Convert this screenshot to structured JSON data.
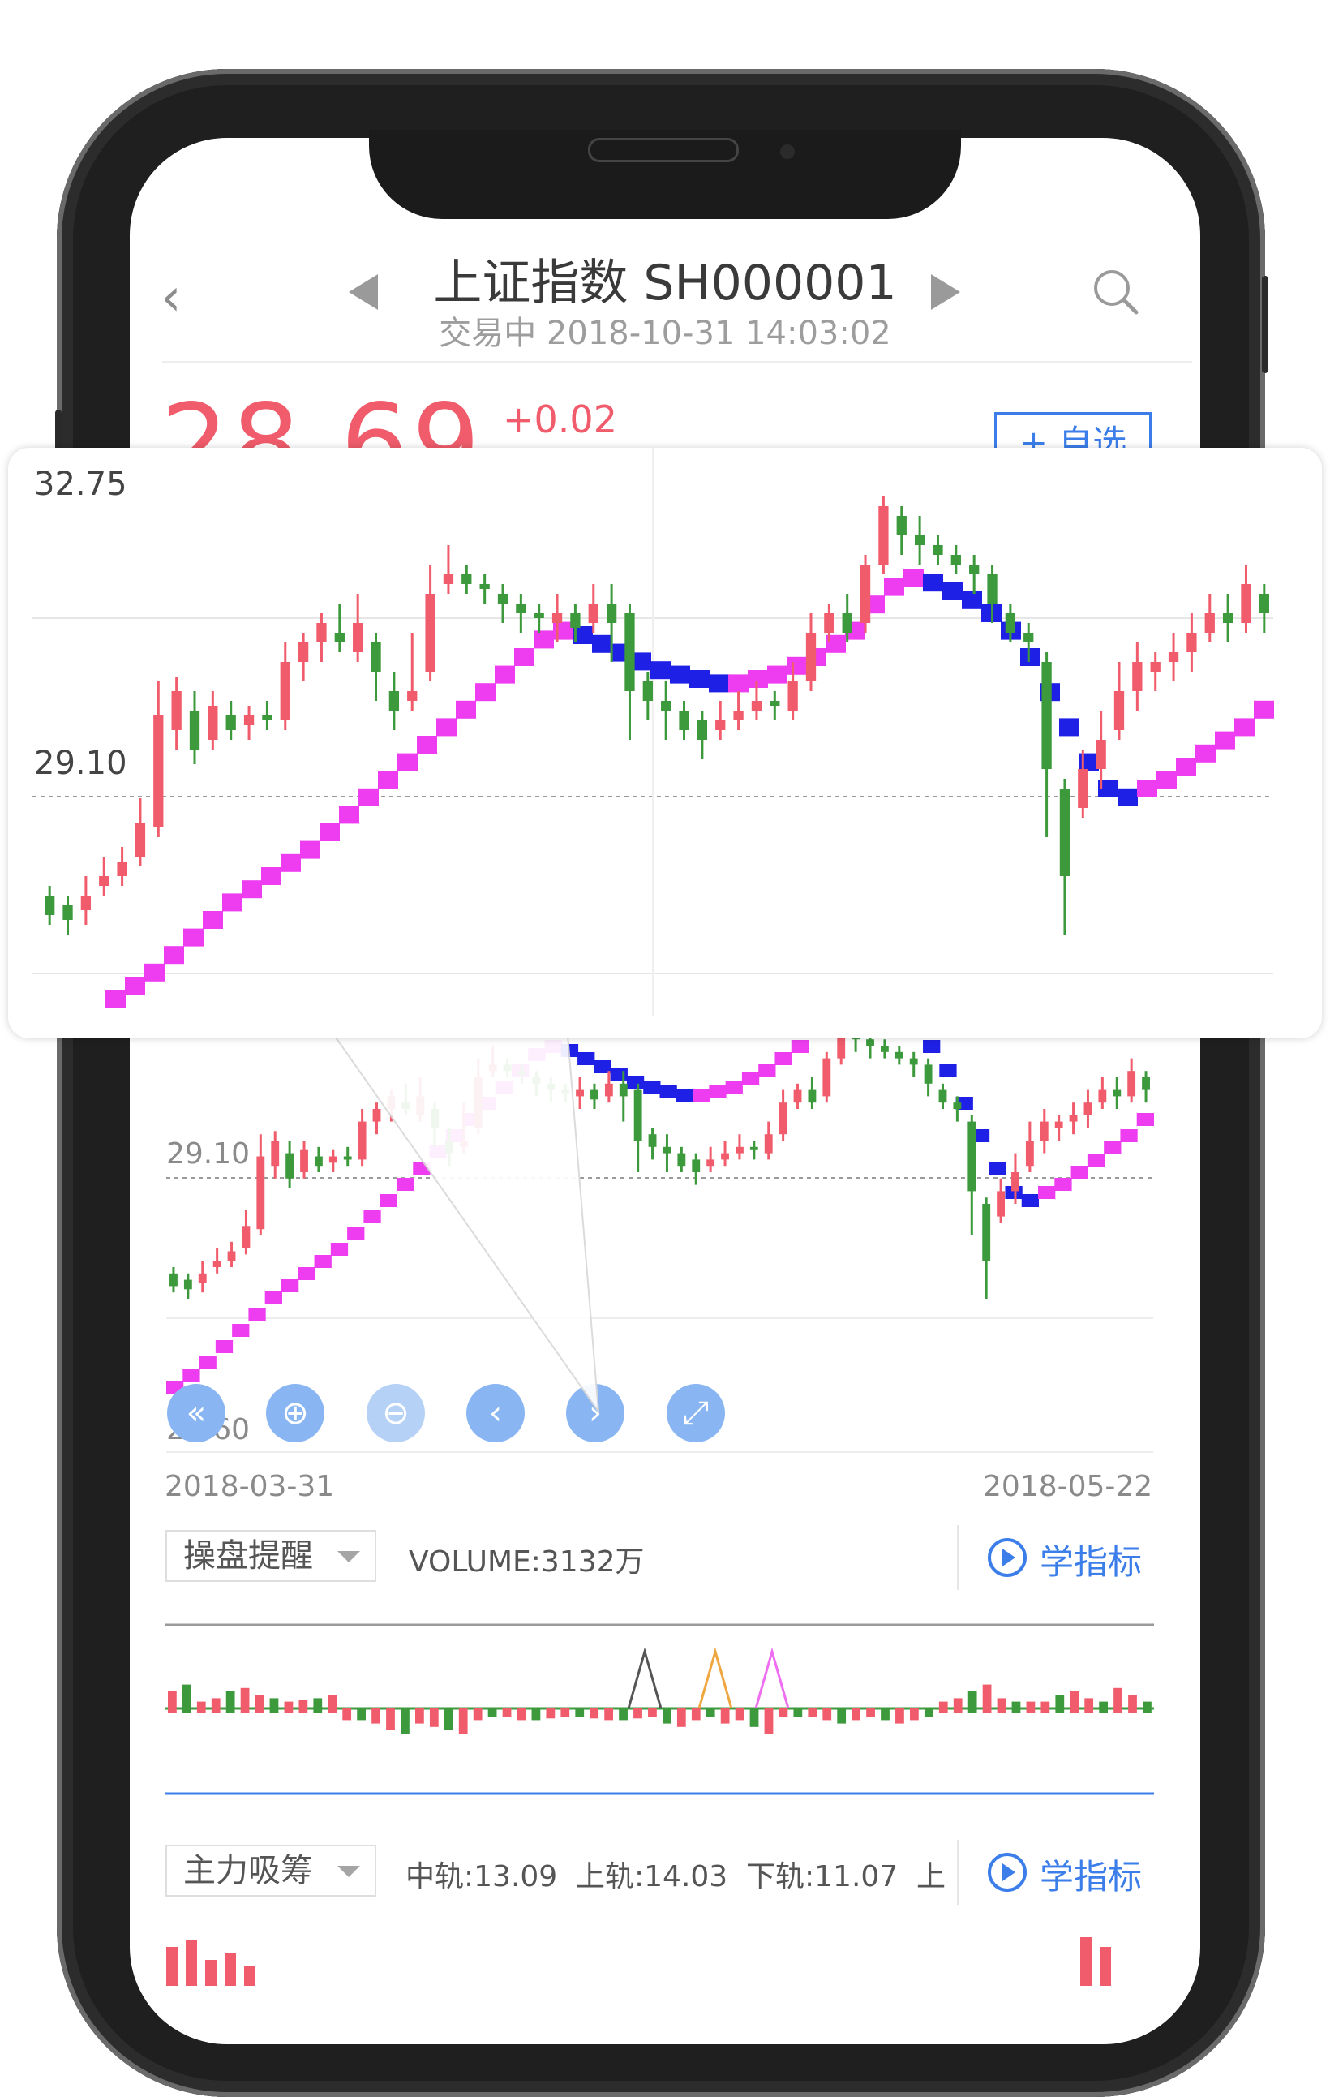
{
  "header": {
    "title": "上证指数  SH000001",
    "status": "交易中  2018-10-31   14:03:02",
    "back_icon": "chevron-left-icon",
    "search_icon": "search-icon"
  },
  "quote": {
    "price": "28.69",
    "change": "+0.02",
    "add_button": "+ 自选",
    "up_color": "#f05c6b",
    "down_color": "#3c9a3c"
  },
  "main_chart": {
    "y_mid": "29.10",
    "y_low": "28.60",
    "x_start": "2018-03-31",
    "x_end": "2018-05-22"
  },
  "toolbar": {
    "buttons": [
      {
        "name": "first-page",
        "icon": "double-chevron-left-icon"
      },
      {
        "name": "zoom-in",
        "icon": "zoom-in-icon"
      },
      {
        "name": "zoom-out",
        "icon": "zoom-out-icon"
      },
      {
        "name": "prev",
        "icon": "arrow-left-icon"
      },
      {
        "name": "next",
        "icon": "arrow-right-icon"
      },
      {
        "name": "fullscreen",
        "icon": "expand-icon"
      }
    ]
  },
  "indicator1": {
    "select": "操盘提醒",
    "text": "VOLUME:3132万",
    "learn": "学指标"
  },
  "indicator2": {
    "select": "主力吸筹",
    "mid": "中轨:13.09",
    "up": "上轨:14.03",
    "down": "下轨:11.07",
    "extra": "上",
    "learn": "学指标"
  },
  "popup": {
    "y_max": "32.75",
    "y_mid": "29.10"
  },
  "chart_data": {
    "type": "candlestick",
    "y_labels": [
      "32.75",
      "29.10",
      "28.60"
    ],
    "ref_line": 29.1,
    "x_start": "2018-03-31",
    "x_end": "2018-05-22",
    "ma_colors": {
      "rising": "#ee3df0",
      "falling": "#1f20e6"
    }
  }
}
